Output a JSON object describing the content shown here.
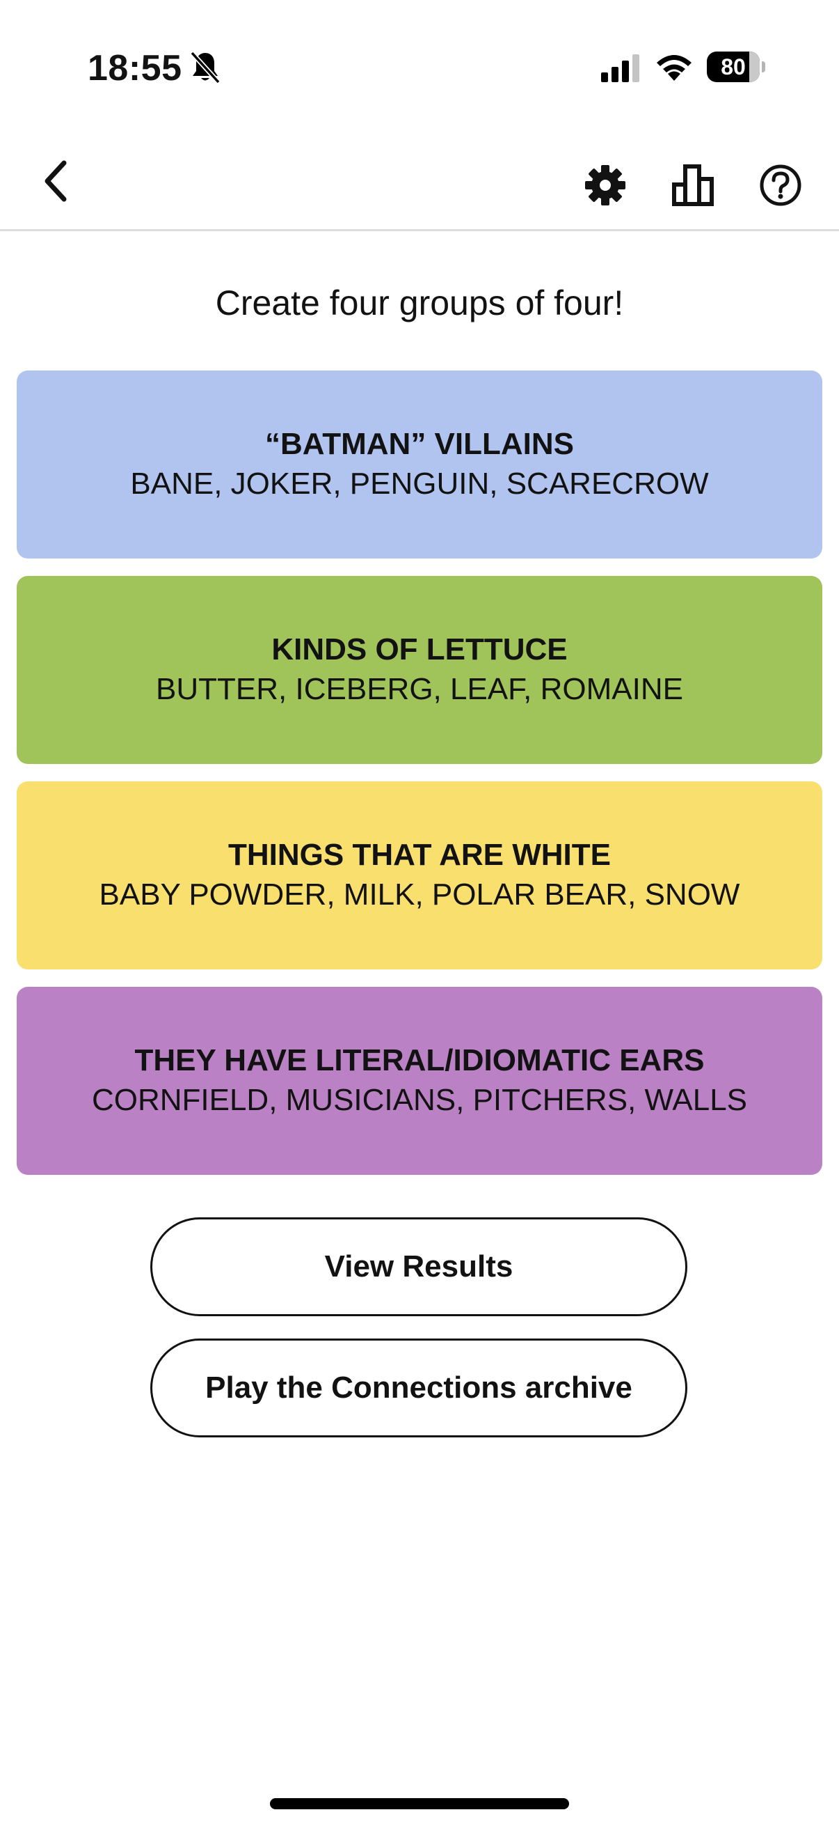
{
  "status_bar": {
    "time": "18:55",
    "battery_level": "80",
    "battery_fraction": 0.8
  },
  "nav": {
    "icons": [
      "chevron-left-icon",
      "gear-icon",
      "bar-chart-icon",
      "question-circle-icon"
    ]
  },
  "main": {
    "instructions": "Create four groups of four!",
    "groups": [
      {
        "title": "“BATMAN” VILLAINS",
        "members": "BANE, JOKER, PENGUIN, SCARECROW",
        "color": "#b0c4ef"
      },
      {
        "title": "KINDS OF LETTUCE",
        "members": "BUTTER, ICEBERG, LEAF, ROMAINE",
        "color": "#a0c35a"
      },
      {
        "title": "THINGS THAT ARE WHITE",
        "members": "BABY POWDER, MILK, POLAR BEAR, SNOW",
        "color": "#f9df6d"
      },
      {
        "title": "THEY HAVE LITERAL/IDIOMATIC EARS",
        "members": "CORNFIELD, MUSICIANS, PITCHERS, WALLS",
        "color": "#ba81c5"
      }
    ],
    "view_results_label": "View Results",
    "archive_label": "Play the Connections archive"
  }
}
